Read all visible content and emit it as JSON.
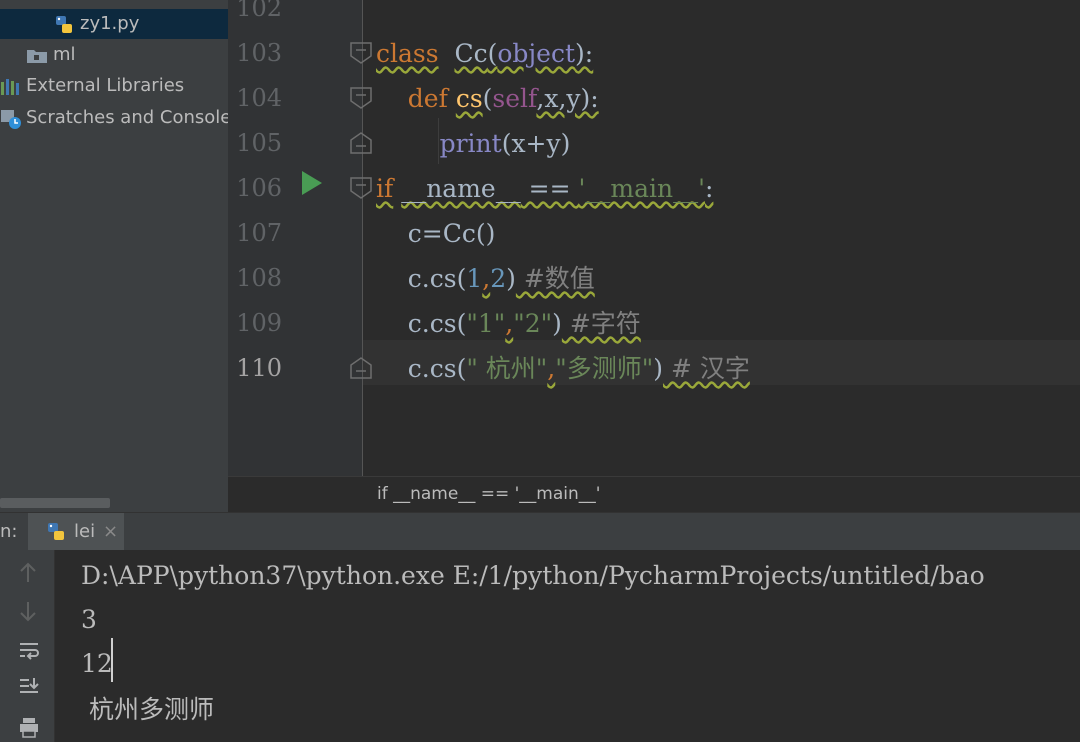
{
  "tree": {
    "items": [
      {
        "label": "zy1.py",
        "icon": "python-file-icon"
      },
      {
        "label": "ml",
        "icon": "folder-icon"
      },
      {
        "label": "External Libraries",
        "icon": "libraries-icon"
      },
      {
        "label": "Scratches and Consoles",
        "icon": "scratches-icon"
      }
    ]
  },
  "editor": {
    "line_numbers": [
      "102",
      "103",
      "104",
      "105",
      "106",
      "107",
      "108",
      "109",
      "110"
    ],
    "current_line": "110",
    "lines": {
      "l103": {
        "kw": "class",
        "name": "Cc",
        "p1": "(",
        "base": "object",
        "p2": "):"
      },
      "l104": {
        "kw": "def",
        "fn": "cs",
        "p1": "(",
        "self": "self",
        "args": ",x,y):"
      },
      "l105": {
        "fn": "print",
        "args": "(x+y)"
      },
      "l106": {
        "kw": "if",
        "dunder": "__name__",
        "op": " == ",
        "str": "'__main__'",
        "colon": ":"
      },
      "l107": {
        "code": "c=Cc()"
      },
      "l108": {
        "pre": "c.cs(",
        "n1": "1",
        "sep": ",",
        "n2": "2",
        "post": ")",
        "comment": " #数值"
      },
      "l109": {
        "pre": "c.cs(",
        "s1": "\"1\"",
        "sep": ",",
        "s2": "\"2\"",
        "post": ")",
        "comment": " #字符"
      },
      "l110": {
        "pre": "c.cs(",
        "s1": "\" 杭州\"",
        "sep": ",",
        "s2": "\"多测师\"",
        "post": ")",
        "comment": " # 汉字"
      }
    }
  },
  "breadcrumb": "if __name__ == '__main__'",
  "run": {
    "label": "n:",
    "tab": "lei",
    "tab_close": "×",
    "console_lines": [
      "D:\\APP\\python37\\python.exe E:/1/python/PycharmProjects/untitled/bao",
      "3",
      "12",
      " 杭州多测师"
    ]
  },
  "colors": {
    "keyword": "#cc7832",
    "string": "#6a8759",
    "number": "#6897bb",
    "function": "#ffc66d",
    "self": "#94558d",
    "builtin": "#8888c6",
    "run_arrow": "#499c54"
  }
}
